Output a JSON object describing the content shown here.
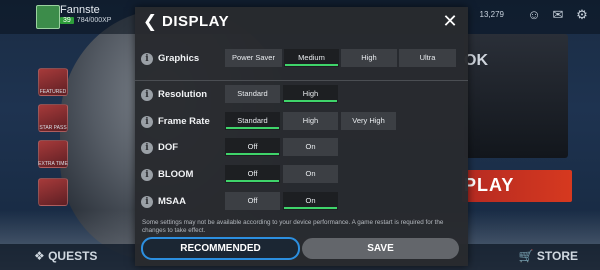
{
  "background": {
    "player_name": "Fannste",
    "player_level": "39",
    "player_xp": "784/000XP",
    "coins": "13,279",
    "tile_labels": [
      "FEATURED",
      "STAR PASS",
      "EXTRA TIME"
    ],
    "card_badge": "OK",
    "play_label": "PLAY",
    "quests_label": "QUESTS",
    "store_label": "STORE"
  },
  "modal": {
    "title": "DISPLAY",
    "back_icon": "chevron-left-icon",
    "close_icon": "close-icon",
    "accent_color": "#3fd46a",
    "rows": [
      {
        "label": "Graphics",
        "options": [
          "Power Saver",
          "Medium",
          "High",
          "Ultra"
        ],
        "selected": "Medium"
      },
      {
        "label": "Resolution",
        "options": [
          "Standard",
          "High"
        ],
        "selected": "High"
      },
      {
        "label": "Frame Rate",
        "options": [
          "Standard",
          "High",
          "Very High"
        ],
        "selected": "Standard"
      },
      {
        "label": "DOF",
        "options": [
          "Off",
          "On"
        ],
        "selected": "Off"
      },
      {
        "label": "BLOOM",
        "options": [
          "Off",
          "On"
        ],
        "selected": "Off"
      },
      {
        "label": "MSAA",
        "options": [
          "Off",
          "On"
        ],
        "selected": "On"
      }
    ],
    "notice": "Some settings may not be available according to your device performance. A game restart is required for the changes to take effect.",
    "recommended_label": "RECOMMENDED",
    "save_label": "SAVE",
    "recommended_border_color": "#2c8fe0"
  }
}
